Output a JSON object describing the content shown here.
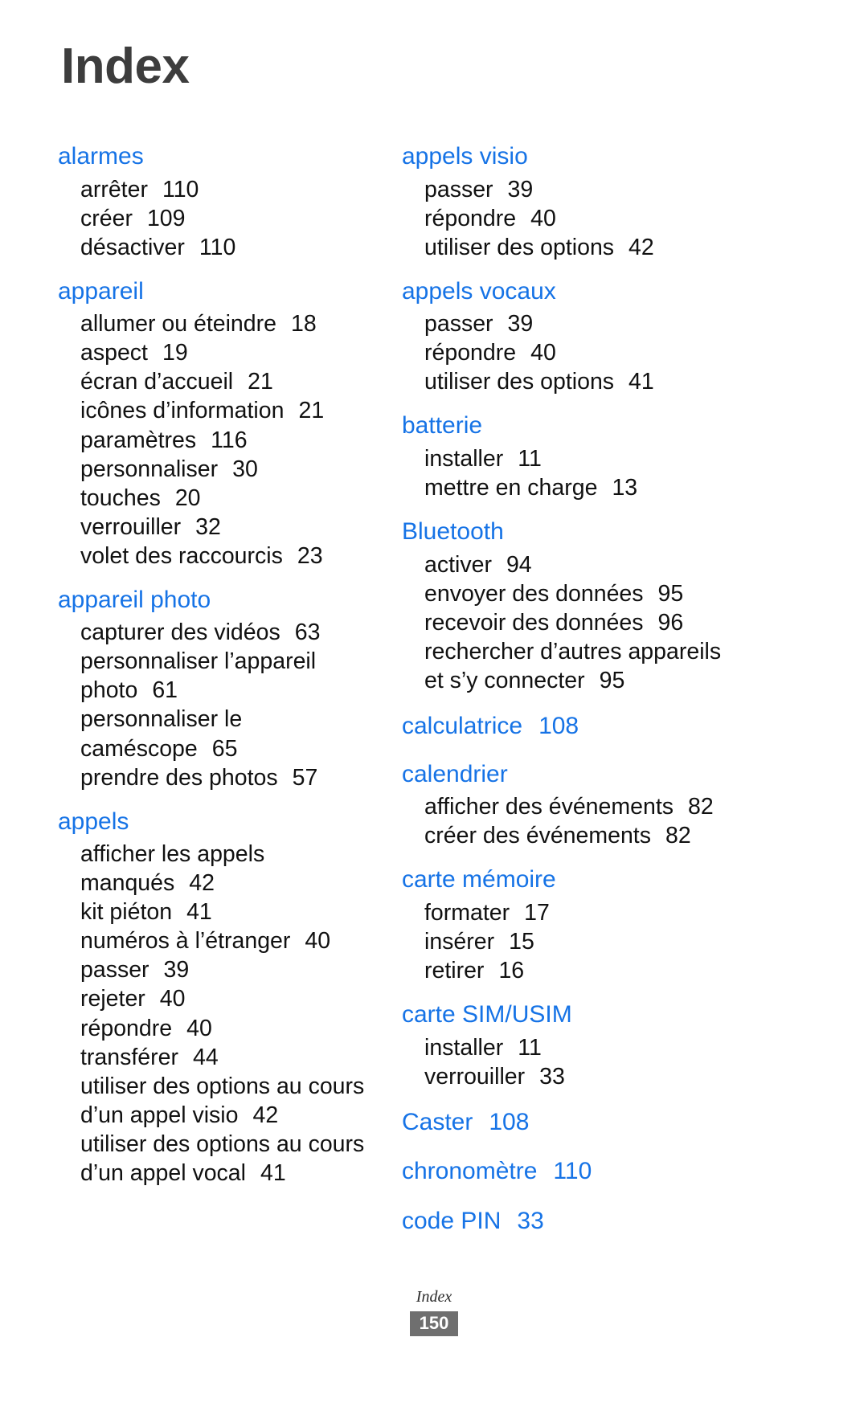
{
  "document": {
    "title": "Index",
    "footer_label": "Index",
    "page_number": "150"
  },
  "colors": {
    "heading_blue": "#1673e6",
    "title_gray": "#3d3d3d",
    "body_black": "#111111",
    "footer_badge_bg": "#6f6f6f"
  },
  "left_column": [
    {
      "term": "alarmes",
      "page": "",
      "entries": [
        {
          "label": "arrêter",
          "page": "110"
        },
        {
          "label": "créer",
          "page": "109"
        },
        {
          "label": "désactiver",
          "page": "110"
        }
      ]
    },
    {
      "term": "appareil",
      "page": "",
      "entries": [
        {
          "label": "allumer ou éteindre",
          "page": "18"
        },
        {
          "label": "aspect",
          "page": "19"
        },
        {
          "label": "écran d’accueil",
          "page": "21"
        },
        {
          "label": "icônes d’information",
          "page": "21"
        },
        {
          "label": "paramètres",
          "page": "116"
        },
        {
          "label": "personnaliser",
          "page": "30"
        },
        {
          "label": "touches",
          "page": "20"
        },
        {
          "label": "verrouiller",
          "page": "32"
        },
        {
          "label": "volet des raccourcis",
          "page": "23"
        }
      ]
    },
    {
      "term": "appareil photo",
      "page": "",
      "entries": [
        {
          "label": "capturer des vidéos",
          "page": "63"
        },
        {
          "label": "personnaliser l’appareil photo",
          "page": "61",
          "wrapped": true
        },
        {
          "label": "personnaliser le caméscope",
          "page": "65",
          "wrapped": true
        },
        {
          "label": "prendre des photos",
          "page": "57"
        }
      ]
    },
    {
      "term": "appels",
      "page": "",
      "entries": [
        {
          "label": "afficher les appels manqués",
          "page": "42",
          "wrapped": true
        },
        {
          "label": "kit piéton",
          "page": "41"
        },
        {
          "label": "numéros à l’étranger",
          "page": "40"
        },
        {
          "label": "passer",
          "page": "39"
        },
        {
          "label": "rejeter",
          "page": "40"
        },
        {
          "label": "répondre",
          "page": "40"
        },
        {
          "label": "transférer",
          "page": "44"
        },
        {
          "label": "utiliser des options au cours d’un appel visio",
          "page": "42",
          "wrapped": true
        },
        {
          "label": "utiliser des options au cours d’un appel vocal",
          "page": "41",
          "wrapped": true
        }
      ]
    }
  ],
  "right_column": [
    {
      "term": "appels visio",
      "page": "",
      "entries": [
        {
          "label": "passer",
          "page": "39"
        },
        {
          "label": "répondre",
          "page": "40"
        },
        {
          "label": "utiliser des options",
          "page": "42"
        }
      ]
    },
    {
      "term": "appels vocaux",
      "page": "",
      "entries": [
        {
          "label": "passer",
          "page": "39"
        },
        {
          "label": "répondre",
          "page": "40"
        },
        {
          "label": "utiliser des options",
          "page": "41"
        }
      ]
    },
    {
      "term": "batterie",
      "page": "",
      "entries": [
        {
          "label": "installer",
          "page": "11"
        },
        {
          "label": "mettre en charge",
          "page": "13"
        }
      ]
    },
    {
      "term": "Bluetooth",
      "page": "",
      "entries": [
        {
          "label": "activer",
          "page": "94"
        },
        {
          "label": "envoyer des données",
          "page": "95"
        },
        {
          "label": "recevoir des données",
          "page": "96"
        },
        {
          "label": "rechercher d’autres appareils et s’y connecter",
          "page": "95",
          "wrapped": true
        }
      ]
    },
    {
      "term": "calculatrice",
      "page": "108",
      "entries": []
    },
    {
      "term": "calendrier",
      "page": "",
      "entries": [
        {
          "label": "afficher des événements",
          "page": "82"
        },
        {
          "label": "créer des événements",
          "page": "82"
        }
      ]
    },
    {
      "term": "carte mémoire",
      "page": "",
      "entries": [
        {
          "label": "formater",
          "page": "17"
        },
        {
          "label": "insérer",
          "page": "15"
        },
        {
          "label": "retirer",
          "page": "16"
        }
      ]
    },
    {
      "term": "carte SIM/USIM",
      "page": "",
      "entries": [
        {
          "label": "installer",
          "page": "11"
        },
        {
          "label": "verrouiller",
          "page": "33"
        }
      ]
    },
    {
      "term": "Caster",
      "page": "108",
      "entries": []
    },
    {
      "term": "chronomètre",
      "page": "110",
      "entries": []
    },
    {
      "term": "code PIN",
      "page": "33",
      "entries": []
    }
  ]
}
